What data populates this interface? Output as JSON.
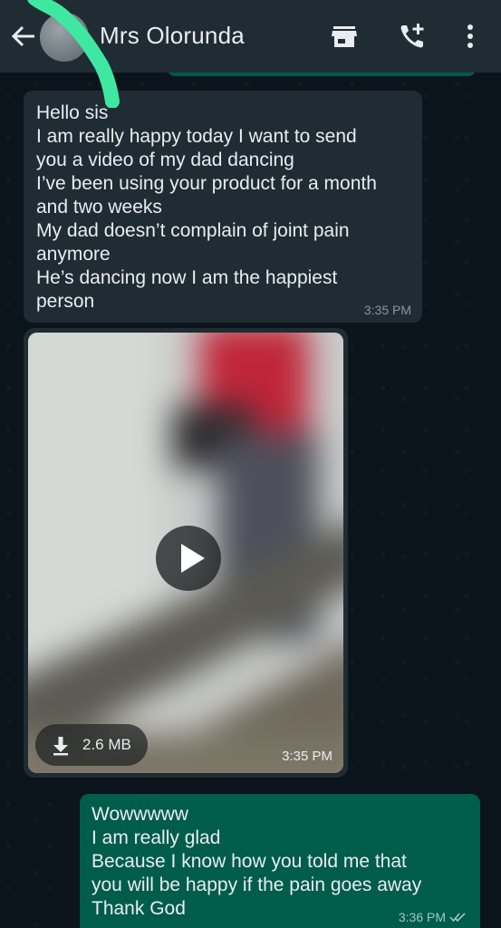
{
  "header": {
    "contact_name": "Mrs Olorunda",
    "icons": [
      "back-arrow-icon",
      "shop-icon",
      "add-call-icon",
      "more-vert-icon"
    ]
  },
  "messages": [
    {
      "direction": "incoming",
      "lines": [
        "Hello sis",
        "I am really happy today I want to send",
        "you a video of my dad dancing",
        "I’ve been using your product for a month",
        "and two weeks",
        "My dad doesn’t complain of joint pain",
        "anymore",
        "He’s dancing now I am the happiest",
        "person"
      ],
      "time": "3:35 PM"
    },
    {
      "direction": "incoming",
      "type": "video",
      "size": "2.6 MB",
      "time": "3:35 PM"
    },
    {
      "direction": "outgoing",
      "lines": [
        "Wowwwww",
        "I am really glad",
        "Because I know how you told me that",
        "you will be happy if the pain goes away",
        "Thank God"
      ],
      "time": "3:36 PM",
      "status": "read"
    }
  ],
  "colors": {
    "header_bg": "#1f2c33",
    "chat_bg": "#0b141a",
    "incoming_bubble": "#1f2c33",
    "outgoing_bubble": "#005c4b",
    "highlighter_mark": "#3ee8a0"
  }
}
